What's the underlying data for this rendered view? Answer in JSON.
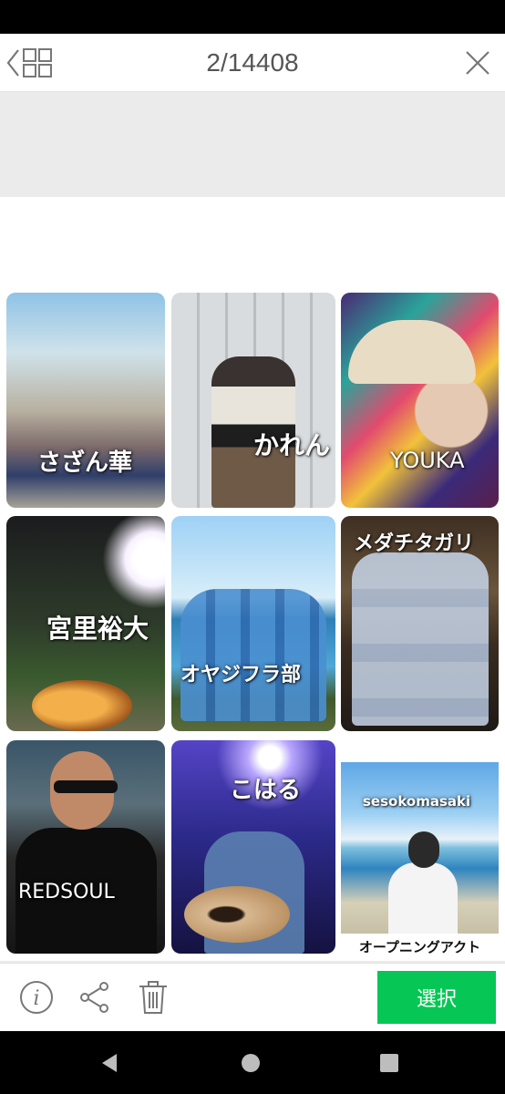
{
  "header": {
    "counter": "2/14408"
  },
  "collage": {
    "tiles": [
      {
        "label": "さざん華"
      },
      {
        "label": "かれん"
      },
      {
        "label": "YOUKA"
      },
      {
        "label": "宮里裕大"
      },
      {
        "label": "オヤジフラ部"
      },
      {
        "label": "メダチタガリ"
      },
      {
        "label": "REDSOUL"
      },
      {
        "label": "こはる"
      },
      {
        "label": "sesokomasaki",
        "caption": "オープニングアクト"
      }
    ]
  },
  "toolbar": {
    "select_label": "選択",
    "accent": "#06c755"
  },
  "icons": [
    "chevron-left-icon",
    "grid-icon",
    "close-icon",
    "info-icon",
    "share-icon",
    "trash-icon",
    "nav-back-icon",
    "nav-home-icon",
    "nav-recents-icon"
  ]
}
